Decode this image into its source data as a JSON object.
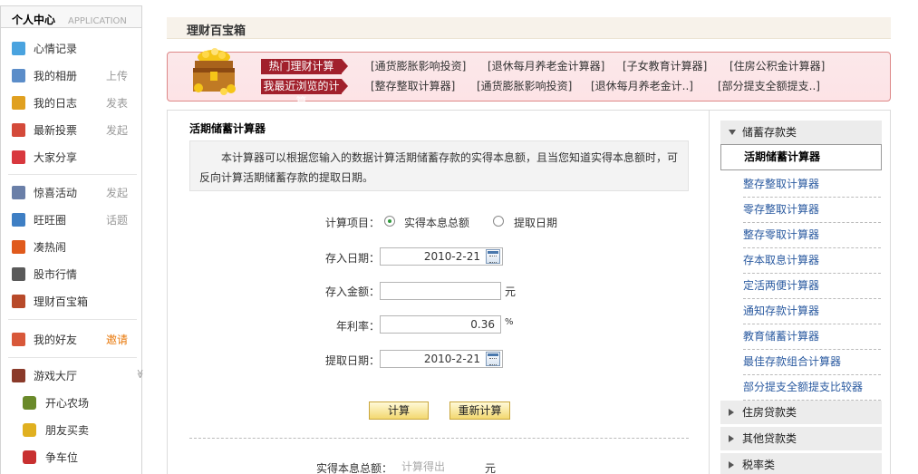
{
  "sidebar": {
    "header": {
      "title": "个人中心",
      "subtitle": "APPLICATION"
    },
    "items": [
      {
        "name": "mood",
        "label": "心情记录",
        "action": "",
        "icon": "speech-bubble-icon",
        "color": "#4aa3df"
      },
      {
        "name": "album",
        "label": "我的相册",
        "action": "上传",
        "icon": "photo-icon",
        "color": "#5b8dc9"
      },
      {
        "name": "diary",
        "label": "我的日志",
        "action": "发表",
        "icon": "notebook-icon",
        "color": "#e0a020"
      },
      {
        "name": "vote",
        "label": "最新投票",
        "action": "发起",
        "icon": "bar-chart-icon",
        "color": "#d44a3a"
      },
      {
        "name": "share",
        "label": "大家分享",
        "action": "",
        "icon": "hearts-icon",
        "color": "#d8383e"
      },
      {
        "name": "event",
        "label": "惊喜活动",
        "action": "发起",
        "icon": "calendar-icon",
        "color": "#6a7fa8"
      },
      {
        "name": "circle",
        "label": "旺旺圈",
        "action": "话题",
        "icon": "people-icon",
        "color": "#3e7fc4"
      },
      {
        "name": "hot",
        "label": "凑热闹",
        "action": "",
        "icon": "fire-icon",
        "color": "#e05a1c"
      },
      {
        "name": "stock",
        "label": "股市行情",
        "action": "",
        "icon": "stock-icon",
        "color": "#5a5a5a"
      },
      {
        "name": "finance",
        "label": "理财百宝箱",
        "action": "",
        "icon": "treasure-box-icon",
        "color": "#b84a2a"
      },
      {
        "name": "friends",
        "label": "我的好友",
        "action": "邀请",
        "icon": "person-icon",
        "color": "#d8583a"
      },
      {
        "name": "games",
        "label": "游戏大厅",
        "action": "",
        "icon": "game-icon",
        "color": "#8a3a2a"
      }
    ],
    "games": [
      {
        "label": "开心农场",
        "icon": "sprout-icon",
        "color": "#6a8a2a"
      },
      {
        "label": "朋友买卖",
        "icon": "coins-icon",
        "color": "#e0b020"
      },
      {
        "label": "争车位",
        "icon": "parking-icon",
        "color": "#c83030"
      }
    ]
  },
  "titlebar": {
    "title": "理财百宝箱"
  },
  "banner": {
    "hot_tag": "热门理财计算",
    "recent_tag": "我最近浏览的计算",
    "hot_links": [
      "[通货膨胀影响投资]",
      "[退休每月养老金计算器]",
      "[子女教育计算器]",
      "[住房公积金计算器]"
    ],
    "recent_links": [
      "[整存整取计算器]",
      "[通货膨胀影响投资]",
      "[退休每月养老金计..]",
      "[部分提支全额提支..]"
    ]
  },
  "calculator": {
    "title": "活期储蓄计算器",
    "description": "本计算器可以根据您输入的数据计算活期储蓄存款的实得本息额，且当您知道实得本息额时，可反向计算活期储蓄存款的提取日期。",
    "item_label": "计算项目：",
    "radio_options": [
      "实得本息总额",
      "提取日期"
    ],
    "deposit_date_label": "存入日期：",
    "deposit_date_value": "2010-2-21",
    "amount_label": "存入金额：",
    "amount_value": "",
    "amount_unit": "元",
    "rate_label": "年利率：",
    "rate_value": "0.36",
    "rate_unit": "%",
    "withdraw_date_label": "提取日期：",
    "withdraw_date_value": "2010-2-21",
    "calc_button": "计算",
    "reset_button": "重新计算",
    "result_label": "实得本息总额：",
    "result_placeholder": "计算得出",
    "result_unit": "元"
  },
  "rightnav": {
    "category_open": "储蓄存款类",
    "active_item": "活期储蓄计算器",
    "links": [
      "整存整取计算器",
      "零存整取计算器",
      "整存零取计算器",
      "存本取息计算器",
      "定活两便计算器",
      "通知存款计算器",
      "教育储蓄计算器",
      "最佳存款组合计算器",
      "部分提支全额提支比较器"
    ],
    "categories": [
      "住房贷款类",
      "其他贷款类",
      "税率类"
    ]
  }
}
